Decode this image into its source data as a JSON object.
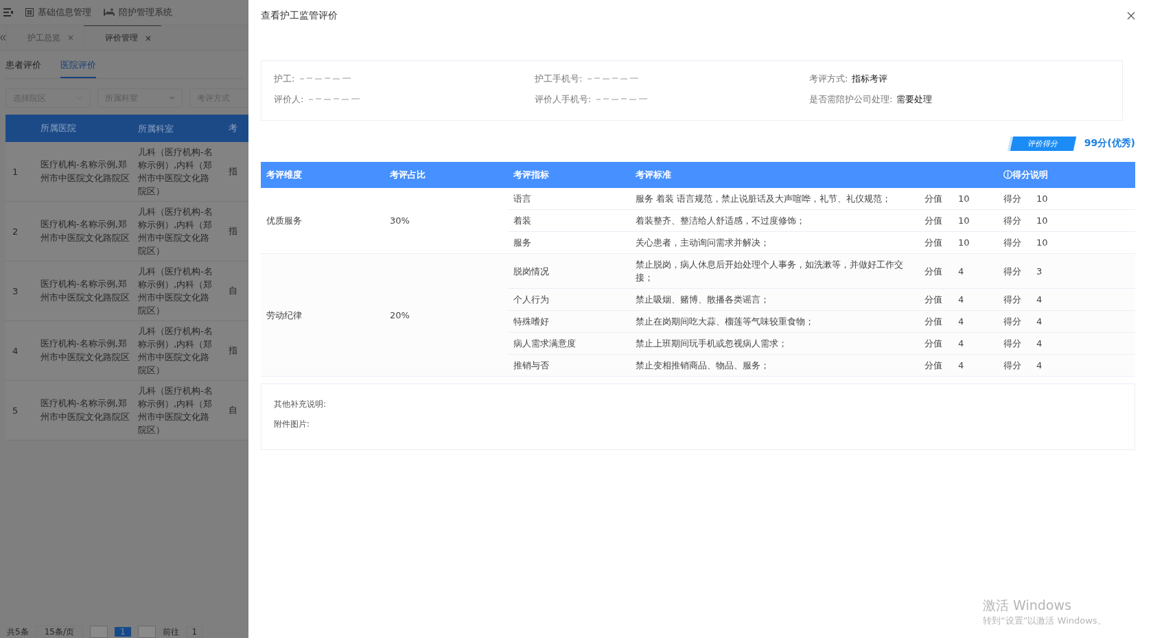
{
  "top_nav": {
    "items": [
      {
        "label": "基础信息管理",
        "kind": "grid"
      },
      {
        "label": "陪护管理系统",
        "kind": "bed"
      }
    ]
  },
  "page_tabs": [
    {
      "label": "护工总览",
      "close": "×",
      "selected": false
    },
    {
      "label": "评价管理",
      "close": "×",
      "selected": true
    }
  ],
  "sub_tabs": [
    {
      "label": "患者评价",
      "selected": false
    },
    {
      "label": "医院评价",
      "selected": true
    }
  ],
  "filters": [
    {
      "placeholder": "选择院区",
      "kind": "chevron"
    },
    {
      "placeholder": "所属科室",
      "kind": "triangle"
    },
    {
      "placeholder": "考评方式",
      "kind": "none"
    }
  ],
  "list_table": {
    "columns": [
      "所属医院",
      "所属科室",
      "考"
    ],
    "rows": [
      {
        "index": "1",
        "hospital": "医疗机构-名称示例,郑州市中医院文化路院区",
        "department": "儿科（医疗机构-名称示例）,内科（郑州市中医院文化路院区）",
        "column_3": "指"
      },
      {
        "index": "2",
        "hospital": "医疗机构-名称示例,郑州市中医院文化路院区",
        "department": "儿科（医疗机构-名称示例）,内科（郑州市中医院文化路院区）",
        "column_3": "指"
      },
      {
        "index": "3",
        "hospital": "医疗机构-名称示例,郑州市中医院文化路院区",
        "department": "儿科（医疗机构-名称示例）,内科（郑州市中医院文化路院区）",
        "column_3": "自"
      },
      {
        "index": "4",
        "hospital": "医疗机构-名称示例,郑州市中医院文化路院区",
        "department": "儿科（医疗机构-名称示例）,内科（郑州市中医院文化路院区）",
        "column_3": "指"
      },
      {
        "index": "5",
        "hospital": "医疗机构-名称示例,郑州市中医院文化路院区",
        "department": "儿科（医疗机构-名称示例）,内科（郑州市中医院文化路院区）",
        "column_3": "自"
      }
    ]
  },
  "pagination": {
    "total": "共5条",
    "page_size": "15条/页",
    "pages": [
      {
        "label": "1",
        "selected": true
      }
    ],
    "goto": "前往",
    "goto_value": "1"
  },
  "drawer": {
    "title": "查看护工监管评价",
    "info": [
      {
        "label": "护工:",
        "kind": "redacted"
      },
      {
        "label": "护工手机号:",
        "kind": "redacted"
      },
      {
        "label": "考评方式:",
        "kind": "text",
        "value": "指标考评"
      },
      {
        "label": "评价人:",
        "kind": "redacted"
      },
      {
        "label": "评价人手机号:",
        "kind": "redacted"
      },
      {
        "label": "是否需陪护公司处理:",
        "kind": "text",
        "value": "需要处理"
      }
    ],
    "score": {
      "badge": "评价得分",
      "value": "99分(优秀)"
    },
    "table": {
      "columns": [
        "考评维度",
        "考评占比",
        "考评指标",
        "考评标准",
        "ⓘ得分说明"
      ],
      "groups": [
        {
          "dimension": "优质服务",
          "ratio": "30%",
          "items": [
            {
              "indicator": "语言",
              "standard": "服务 着装 语言规范，禁止说脏话及大声喧哗，礼节、礼仪规范；",
              "value_label": "分值",
              "value": "10",
              "score_label": "得分",
              "score": "10"
            },
            {
              "indicator": "着装",
              "standard": "着装整齐、整洁给人舒适感，不过度修饰；",
              "value_label": "分值",
              "value": "10",
              "score_label": "得分",
              "score": "10"
            },
            {
              "indicator": "服务",
              "standard": "关心患者，主动询问需求并解决；",
              "value_label": "分值",
              "value": "10",
              "score_label": "得分",
              "score": "10"
            }
          ]
        },
        {
          "dimension": "劳动纪律",
          "ratio": "20%",
          "items": [
            {
              "indicator": "脱岗情况",
              "standard": "禁止脱岗，病人休息后开始处理个人事务，如洗漱等，并做好工作交接；",
              "value_label": "分值",
              "value": "4",
              "score_label": "得分",
              "score": "3"
            },
            {
              "indicator": "个人行为",
              "standard": "禁止吸烟、赌博、散播各类谣言；",
              "value_label": "分值",
              "value": "4",
              "score_label": "得分",
              "score": "4"
            },
            {
              "indicator": "特殊嗜好",
              "standard": "禁止在岗期间吃大蒜、榴莲等气味较重食物；",
              "value_label": "分值",
              "value": "4",
              "score_label": "得分",
              "score": "4"
            },
            {
              "indicator": "病人需求满意度",
              "standard": "禁止上班期间玩手机或忽视病人需求；",
              "value_label": "分值",
              "value": "4",
              "score_label": "得分",
              "score": "4"
            },
            {
              "indicator": "推销与否",
              "standard": "禁止变相推销商品、物品、服务；",
              "value_label": "分值",
              "value": "4",
              "score_label": "得分",
              "score": "4"
            }
          ]
        }
      ]
    },
    "notes": [
      "其他补充说明:",
      "附件图片:"
    ]
  },
  "os_notice": {
    "title": "激活 Windows",
    "hint": "转到“设置”以激活 Windows。"
  }
}
